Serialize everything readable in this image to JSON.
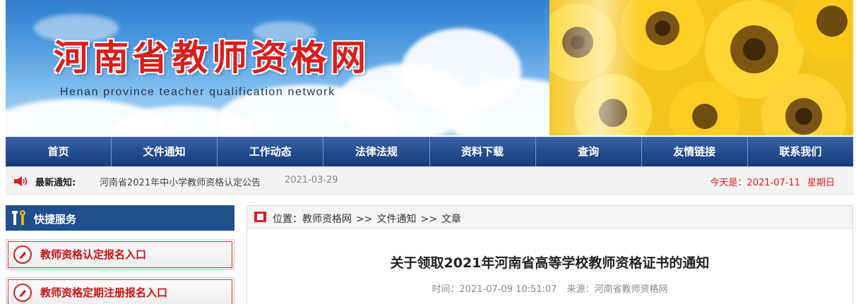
{
  "header": {
    "title": "河南省教师资格网",
    "subtitle": "Henan province teacher qualification network"
  },
  "nav": {
    "items": [
      "首页",
      "文件通知",
      "工作动态",
      "法律法规",
      "资料下载",
      "查询",
      "友情链接",
      "联系我们"
    ]
  },
  "notice": {
    "icon": "speaker-icon",
    "label": "最新通知:",
    "link_text": "河南省2021年中小学教师资格认定公告",
    "date": "2021-03-29",
    "today_label": "今天是：2021-07-11",
    "weekday": "星期日",
    "accent_color": "#e01a1a"
  },
  "sidebar": {
    "title": "快捷服务",
    "title_icon": "tools-icon",
    "items": [
      {
        "label": "教师资格认定报名入口",
        "icon": "pencil-icon"
      },
      {
        "label": "教师资格定期注册报名入口",
        "icon": "pencil-icon"
      }
    ]
  },
  "breadcrumb": {
    "prefix": "位置：",
    "items": [
      "教师资格网",
      "文件通知",
      "文章"
    ],
    "separator": ">>"
  },
  "article": {
    "title": "关于领取2021年河南省高等学校教师资格证书的通知",
    "time": "时间：2021-07-09 10:51:07",
    "source": "来源：河南省教师资格网"
  },
  "colors": {
    "nav_bg": "#234b8e",
    "sidebar_header_bg": "#1f4f8c",
    "brand_red": "#d81e1e"
  }
}
